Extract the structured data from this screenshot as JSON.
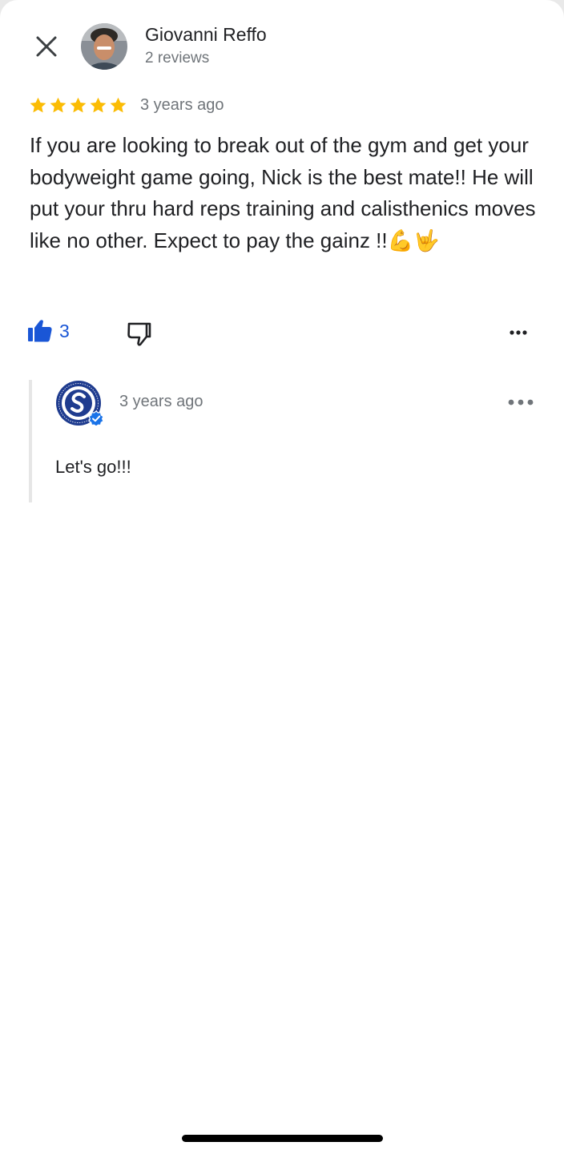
{
  "header": {
    "author_name": "Giovanni Reffo",
    "author_subtitle": "2 reviews",
    "close_icon": "close-icon",
    "avatar": "user-avatar-photo"
  },
  "review": {
    "rating": 5,
    "rating_max": 5,
    "star_color": "#fbbc04",
    "time": "3 years ago",
    "text": "If you are looking to break out of the gym and get your bodyweight game going, Nick is the best mate!! He will put your thru hard reps training and calisthenics moves like no other. Expect to pay the gainz !!💪🤟"
  },
  "actions": {
    "like_count": "3",
    "like_icon": "thumbs-up-icon",
    "dislike_icon": "thumbs-down-icon",
    "more_icon": "more-horizontal-icon",
    "accent_color": "#1a56d6"
  },
  "owner_reply": {
    "logo": "owner-logo",
    "verified_icon": "verified-badge-icon",
    "time": "3 years ago",
    "text": "Let's go!!!",
    "more_icon": "more-horizontal-icon"
  }
}
